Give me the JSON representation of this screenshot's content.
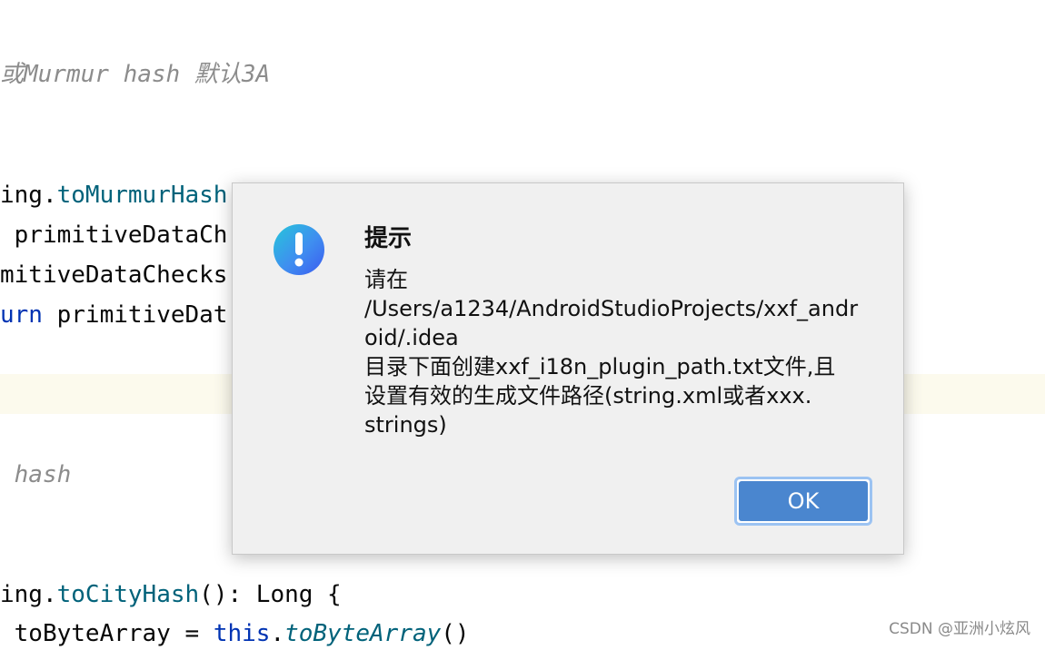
{
  "editor": {
    "lines": [
      {
        "id": "comment1",
        "segments": [
          {
            "text": "或Murmur hash 默认3A",
            "cls": "comment"
          }
        ]
      },
      {
        "id": "l1",
        "segments": [
          {
            "text": "ing.",
            "cls": ""
          },
          {
            "text": "toMurmurHash",
            "cls": "fn"
          }
        ]
      },
      {
        "id": "l2",
        "segments": [
          {
            "text": " primitiveDataCh",
            "cls": ""
          }
        ]
      },
      {
        "id": "l3",
        "segments": [
          {
            "text": "mitiveDataChecks",
            "cls": ""
          }
        ]
      },
      {
        "id": "l4",
        "segments": [
          {
            "text": "urn",
            "cls": "kw"
          },
          {
            "text": " primitiveDat",
            "cls": ""
          }
        ]
      },
      {
        "id": "comment2",
        "segments": [
          {
            "text": " hash",
            "cls": "comment"
          }
        ]
      },
      {
        "id": "l5",
        "segments": [
          {
            "text": "ing.",
            "cls": ""
          },
          {
            "text": "toCityHash",
            "cls": "fn"
          },
          {
            "text": "(): Long {",
            "cls": ""
          }
        ]
      },
      {
        "id": "l6",
        "segments": [
          {
            "text": " toByteArray = ",
            "cls": ""
          },
          {
            "text": "this",
            "cls": "kw"
          },
          {
            "text": ".",
            "cls": ""
          },
          {
            "text": "toByteArray",
            "cls": "fn-italic"
          },
          {
            "text": "()",
            "cls": ""
          }
        ]
      }
    ]
  },
  "dialog": {
    "icon": "exclamation-icon",
    "title": "提示",
    "message": "请在\n/Users/a1234/AndroidStudioProjects/xxf_andr\noid/.idea\n目录下面创建xxf_i18n_plugin_path.txt文件,且\n设置有效的生成文件路径(string.xml或者xxx.\nstrings)",
    "ok_label": "OK"
  },
  "watermark": "CSDN @亚洲小炫风",
  "colors": {
    "accent": "#4a86cf",
    "icon_gradient_start": "#26c6da",
    "icon_gradient_end": "#3b5bef",
    "highlight_row": "#fcfaed"
  }
}
